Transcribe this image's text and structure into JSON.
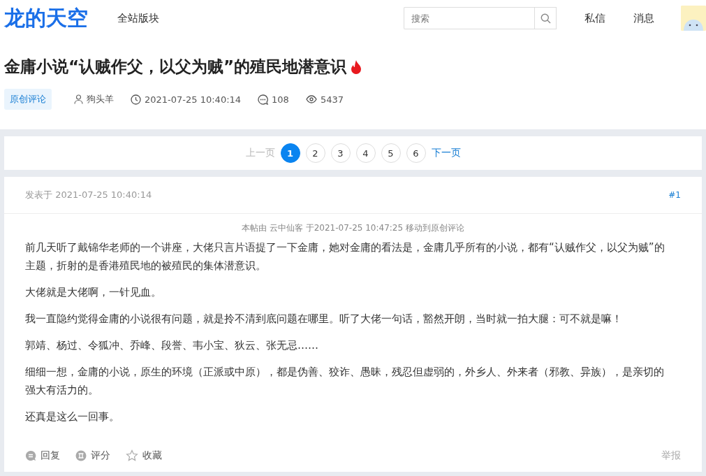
{
  "header": {
    "logo": "龙的天空",
    "nav": "全站版块",
    "search": {
      "placeholder": "搜索"
    },
    "links": [
      "私信",
      "消息"
    ]
  },
  "thread": {
    "title": "金庸小说“认贼作父，以父为贼”的殖民地潜意识",
    "hot": true,
    "forum": "原创评论",
    "author": "狗头羊",
    "time": "2021-07-25 10:40:14",
    "replies": "108",
    "views": "5437"
  },
  "pagination": {
    "prev": "上一页",
    "next": "下一页",
    "pages": [
      {
        "label": "1",
        "selected": true
      },
      {
        "label": "2",
        "selected": false
      },
      {
        "label": "3",
        "selected": false
      },
      {
        "label": "4",
        "selected": false
      },
      {
        "label": "5",
        "selected": false
      },
      {
        "label": "6",
        "selected": false
      }
    ]
  },
  "post": {
    "posted": "发表于 2021-07-25 10:40:14",
    "floor": "#1",
    "notice": "本帖由 云中仙客 于2021-07-25 10:47:25 移动到原创评论",
    "paragraphs": [
      "前几天听了戴锦华老师的一个讲座，大佬只言片语提了一下金庸，她对金庸的看法是，金庸几乎所有的小说，都有“认贼作父，以父为贼”的主题，折射的是香港殖民地的被殖民的集体潜意识。",
      "大佬就是大佬啊，一针见血。",
      "我一直隐约觉得金庸的小说很有问题，就是拎不清到底问题在哪里。听了大佬一句话，豁然开朗，当时就一拍大腿：可不就是嘛！",
      "郭靖、杨过、令狐冲、乔峰、段誉、韦小宝、狄云、张无忌……",
      "细细一想，金庸的小说，原生的环境（正派或中原），都是伪善、狡诈、愚昧，残忍但虚弱的，外乡人、外来者（邪教、异族），是亲切的强大有活力的。",
      "还真是这么一回事。"
    ],
    "actions": [
      {
        "kind": "reply",
        "label": "回复"
      },
      {
        "kind": "rate",
        "label": "评分"
      },
      {
        "kind": "favorite",
        "label": "收藏"
      }
    ],
    "report": "举报"
  }
}
